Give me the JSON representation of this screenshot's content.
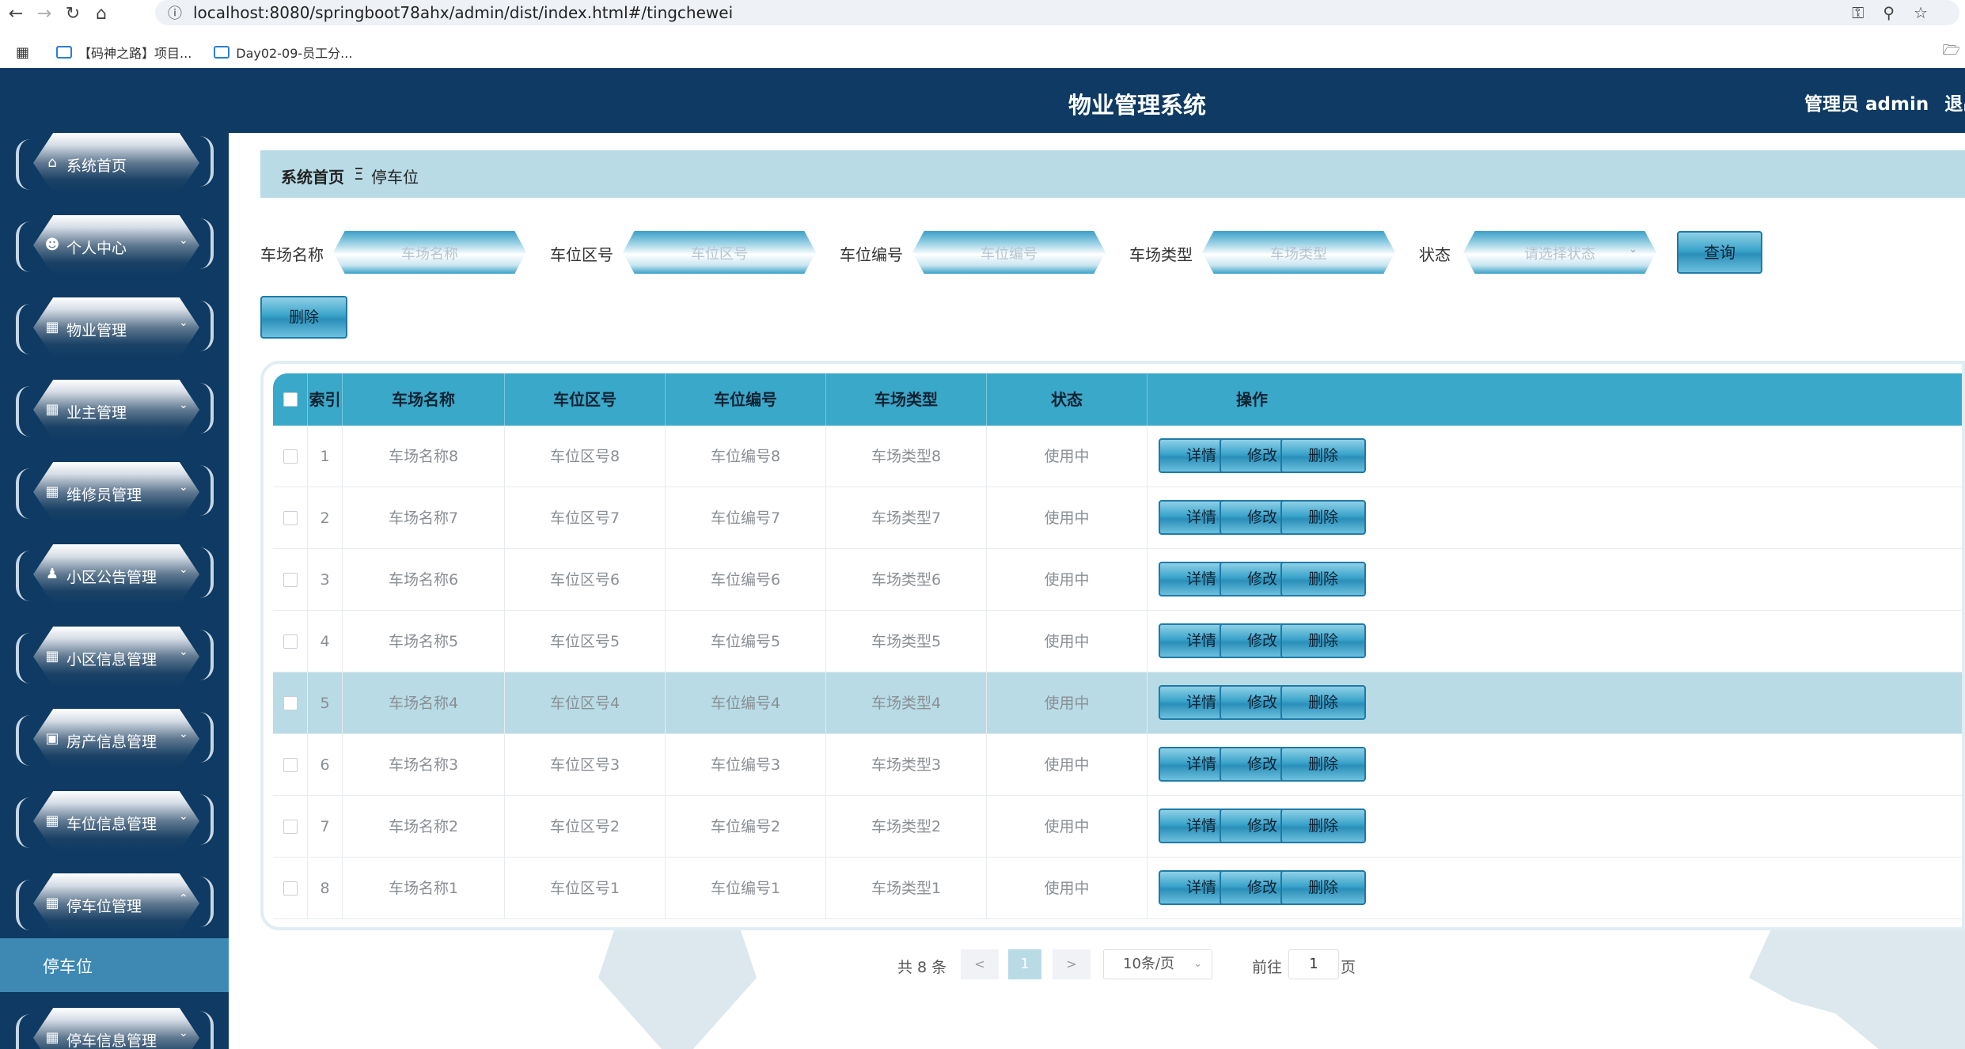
{
  "browser": {
    "url": "localhost:8080/springboot78ahx/admin/dist/index.html#/tingchewei",
    "bookmarks": [
      "【码神之路】项目...",
      "Day02-09-员工分..."
    ]
  },
  "header": {
    "title": "物业管理系统",
    "user": "管理员 admin",
    "logout": "退出"
  },
  "sidebar": {
    "items": [
      {
        "label": "系统首页",
        "icon": "home-icon"
      },
      {
        "label": "个人中心",
        "icon": "user-icon"
      },
      {
        "label": "物业管理",
        "icon": "grid-icon"
      },
      {
        "label": "业主管理",
        "icon": "grid-icon"
      },
      {
        "label": "维修员管理",
        "icon": "apps-icon"
      },
      {
        "label": "小区公告管理",
        "icon": "person-icon"
      },
      {
        "label": "小区信息管理",
        "icon": "grid-icon"
      },
      {
        "label": "房产信息管理",
        "icon": "monitor-icon"
      },
      {
        "label": "车位信息管理",
        "icon": "grid-icon"
      },
      {
        "label": "停车位管理",
        "icon": "grid-icon"
      },
      {
        "label": "停车信息管理",
        "icon": "grid-icon"
      }
    ],
    "submenu_active": "停车位"
  },
  "breadcrumb": {
    "home": "系统首页",
    "separator": "Ξ",
    "current": "停车位"
  },
  "search": {
    "fields": [
      {
        "label": "车场名称",
        "placeholder": "车场名称"
      },
      {
        "label": "车位区号",
        "placeholder": "车位区号"
      },
      {
        "label": "车位编号",
        "placeholder": "车位编号"
      },
      {
        "label": "车场类型",
        "placeholder": "车场类型"
      },
      {
        "label": "状态",
        "placeholder": "请选择状态"
      }
    ],
    "query_label": "查询",
    "delete_label": "删除"
  },
  "table": {
    "columns": [
      "索引",
      "车场名称",
      "车位区号",
      "车位编号",
      "车场类型",
      "状态",
      "操作"
    ],
    "rows": [
      [
        "1",
        "车场名称8",
        "车位区号8",
        "车位编号8",
        "车场类型8",
        "使用中"
      ],
      [
        "2",
        "车场名称7",
        "车位区号7",
        "车位编号7",
        "车场类型7",
        "使用中"
      ],
      [
        "3",
        "车场名称6",
        "车位区号6",
        "车位编号6",
        "车场类型6",
        "使用中"
      ],
      [
        "4",
        "车场名称5",
        "车位区号5",
        "车位编号5",
        "车场类型5",
        "使用中"
      ],
      [
        "5",
        "车场名称4",
        "车位区号4",
        "车位编号4",
        "车场类型4",
        "使用中"
      ],
      [
        "6",
        "车场名称3",
        "车位区号3",
        "车位编号3",
        "车场类型3",
        "使用中"
      ],
      [
        "7",
        "车场名称2",
        "车位区号2",
        "车位编号2",
        "车场类型2",
        "使用中"
      ],
      [
        "8",
        "车场名称1",
        "车位区号1",
        "车位编号1",
        "车场类型1",
        "使用中"
      ]
    ],
    "actions": [
      "详情",
      "修改",
      "删除"
    ],
    "selected_row": 4
  },
  "pagination": {
    "total": "共 8 条",
    "prev": "<",
    "current": "1",
    "next": ">",
    "page_size": "10条/页",
    "goto": "前往",
    "goto_value": "1",
    "page_suffix": "页"
  },
  "colors": {
    "header_bg": "#0e3a63",
    "accent": "#3aa8c8",
    "breadcrumb_bg": "#b8dbe6"
  }
}
